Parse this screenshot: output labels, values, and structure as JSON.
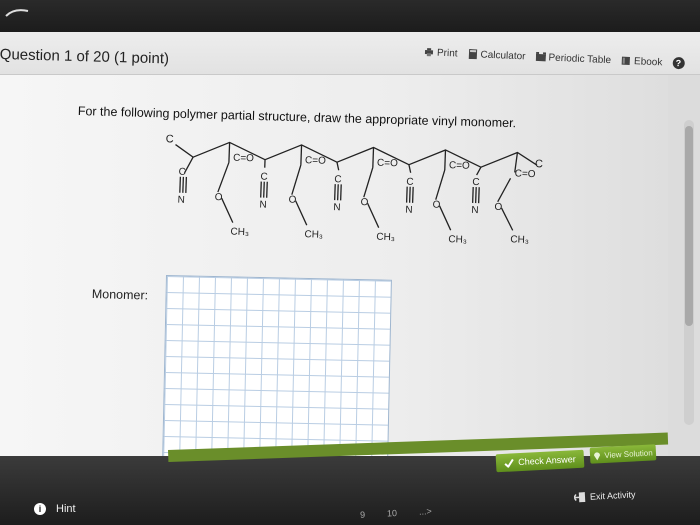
{
  "header": {
    "question_title": "Question 1 of 20 (1 point)",
    "tools": [
      {
        "label": "Print",
        "icon": "printer-icon"
      },
      {
        "label": "Calculator",
        "icon": "calculator-icon"
      },
      {
        "label": "Periodic Table",
        "icon": "periodic-table-icon"
      },
      {
        "label": "Ebook",
        "icon": "book-icon"
      }
    ],
    "help_glyph": "?"
  },
  "question": {
    "prompt": "For the following polymer partial structure, draw the appropriate vinyl monomer.",
    "monomer_label": "Monomer:"
  },
  "structure": {
    "end_label": "C",
    "carbonyl": "C=O",
    "oxygen": "O",
    "nitrile_carbon": "C",
    "nitrile_nitrogen": "N",
    "methyl": "CH₃"
  },
  "footer": {
    "check_answer": "Check Answer",
    "view_solution": "View Solution",
    "exit_activity": "Exit Activity",
    "hint": "Hint",
    "hint_glyph": "i",
    "pager": [
      "9",
      "10",
      "...>"
    ]
  },
  "colors": {
    "top_bar": "#1c1c1c",
    "accent_green": "#6a8e2a",
    "grid_line": "#b9cde3"
  }
}
